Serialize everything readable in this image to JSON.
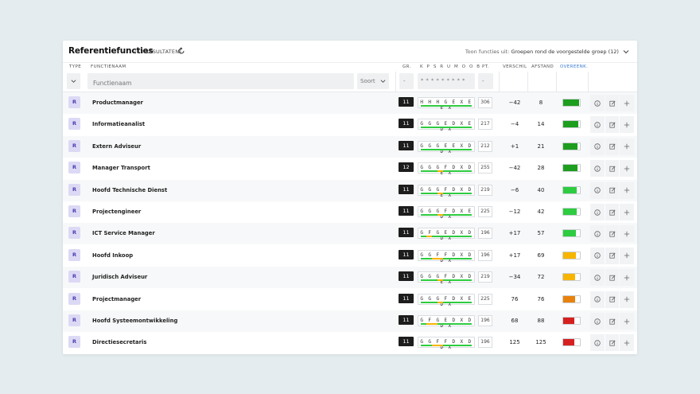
{
  "header": {
    "title": "Referentiefuncties",
    "count": "(43 RESULTATEN)",
    "filter_prefix": "Toon functies uit:",
    "filter_value": "Groepen rond de voorgestelde groep (12)"
  },
  "columns": {
    "type": "TYPE",
    "name": "FUNCTIENAAM",
    "gr": "GR.",
    "codes": "K P S R U M O O B",
    "pt": "PT.",
    "verschil": "VERSCHIL",
    "afstand": "AFSTAND",
    "overeenk": "OVEREENK."
  },
  "filters": {
    "name_placeholder": "Functienaam",
    "sort_label": "Soort",
    "gr_value": "-",
    "codes_value": "* * * * * * * * *",
    "pt_value": "-"
  },
  "colors": {
    "accent": "#3a7bd5",
    "badge_bg": "#dcd9f5",
    "badge_text": "#4b3fb0",
    "green_dark": "#1e9e1e",
    "green_light": "#2ecc40",
    "yellow": "#f7b500",
    "orange": "#e8820c",
    "red": "#d62020"
  },
  "rows": [
    {
      "type": "R",
      "name": "Productmanager",
      "gr": "11",
      "codes": "H H H G E X E E X",
      "pt": "306",
      "verschil": "−42",
      "afstand": "8",
      "match_level": 0.95,
      "match_color": "#1e9e1e",
      "code_colors": [
        "#2ecc40",
        "#2ecc40",
        "#2ecc40",
        "#2ecc40",
        "#2ecc40",
        "#2ecc40",
        "#2ecc40",
        "#2ecc40",
        "#2ecc40"
      ]
    },
    {
      "type": "R",
      "name": "Informatieanalist",
      "gr": "11",
      "codes": "G G G E D X E D X",
      "pt": "217",
      "verschil": "−4",
      "afstand": "14",
      "match_level": 0.9,
      "match_color": "#1e9e1e",
      "code_colors": [
        "#2ecc40",
        "#2ecc40",
        "#2ecc40",
        "#2ecc40",
        "#2ecc40",
        "#2ecc40",
        "#2ecc40",
        "#2ecc40",
        "#2ecc40"
      ]
    },
    {
      "type": "R",
      "name": "Extern Adviseur",
      "gr": "11",
      "codes": "G G G E E X D D X",
      "pt": "212",
      "verschil": "+1",
      "afstand": "21",
      "match_level": 0.88,
      "match_color": "#1e9e1e",
      "code_colors": [
        "#2ecc40",
        "#2ecc40",
        "#2ecc40",
        "#2ecc40",
        "#2ecc40",
        "#2ecc40",
        "#2ecc40",
        "#2ecc40",
        "#2ecc40"
      ]
    },
    {
      "type": "R",
      "name": "Manager Transport",
      "gr": "12",
      "codes": "G G G F D X D E X",
      "pt": "255",
      "verschil": "−42",
      "afstand": "28",
      "match_level": 0.85,
      "match_color": "#1e9e1e",
      "code_colors": [
        "#2ecc40",
        "#2ecc40",
        "#2ecc40",
        "#f7b500",
        "#2ecc40",
        "#2ecc40",
        "#2ecc40",
        "#2ecc40",
        "#2ecc40"
      ]
    },
    {
      "type": "R",
      "name": "Hoofd Technische Dienst",
      "gr": "11",
      "codes": "G G G F D X D E X",
      "pt": "219",
      "verschil": "−6",
      "afstand": "40",
      "match_level": 0.8,
      "match_color": "#2ecc40",
      "code_colors": [
        "#2ecc40",
        "#2ecc40",
        "#2ecc40",
        "#f7b500",
        "#2ecc40",
        "#2ecc40",
        "#2ecc40",
        "#2ecc40",
        "#2ecc40"
      ]
    },
    {
      "type": "R",
      "name": "Projectengineer",
      "gr": "11",
      "codes": "G G G F D X E D X",
      "pt": "225",
      "verschil": "−12",
      "afstand": "42",
      "match_level": 0.8,
      "match_color": "#2ecc40",
      "code_colors": [
        "#2ecc40",
        "#2ecc40",
        "#2ecc40",
        "#f7b500",
        "#2ecc40",
        "#2ecc40",
        "#2ecc40",
        "#2ecc40",
        "#2ecc40"
      ]
    },
    {
      "type": "R",
      "name": "ICT Service Manager",
      "gr": "11",
      "codes": "G F G E D X D D X",
      "pt": "196",
      "verschil": "+17",
      "afstand": "57",
      "match_level": 0.78,
      "match_color": "#2ecc40",
      "code_colors": [
        "#2ecc40",
        "#f7b500",
        "#2ecc40",
        "#2ecc40",
        "#2ecc40",
        "#2ecc40",
        "#2ecc40",
        "#2ecc40",
        "#2ecc40"
      ]
    },
    {
      "type": "R",
      "name": "Hoofd Inkoop",
      "gr": "11",
      "codes": "G G F F D X D D X",
      "pt": "196",
      "verschil": "+17",
      "afstand": "69",
      "match_level": 0.75,
      "match_color": "#f7b500",
      "code_colors": [
        "#2ecc40",
        "#2ecc40",
        "#f7b500",
        "#f7b500",
        "#2ecc40",
        "#2ecc40",
        "#2ecc40",
        "#2ecc40",
        "#2ecc40"
      ]
    },
    {
      "type": "R",
      "name": "Juridisch Adviseur",
      "gr": "11",
      "codes": "G G G F D X D E X",
      "pt": "219",
      "verschil": "−34",
      "afstand": "72",
      "match_level": 0.72,
      "match_color": "#f7b500",
      "code_colors": [
        "#2ecc40",
        "#2ecc40",
        "#2ecc40",
        "#f7b500",
        "#2ecc40",
        "#2ecc40",
        "#2ecc40",
        "#2ecc40",
        "#2ecc40"
      ]
    },
    {
      "type": "R",
      "name": "Projectmanager",
      "gr": "11",
      "codes": "G G G F D X E D X",
      "pt": "225",
      "verschil": "76",
      "afstand": "76",
      "match_level": 0.7,
      "match_color": "#e8820c",
      "code_colors": [
        "#2ecc40",
        "#2ecc40",
        "#2ecc40",
        "#f7b500",
        "#2ecc40",
        "#2ecc40",
        "#2ecc40",
        "#2ecc40",
        "#2ecc40"
      ]
    },
    {
      "type": "R",
      "name": "Hoofd Systeemontwikkeling",
      "gr": "11",
      "codes": "G F G E D X D D X",
      "pt": "196",
      "verschil": "68",
      "afstand": "88",
      "match_level": 0.65,
      "match_color": "#d62020",
      "code_colors": [
        "#2ecc40",
        "#f7b500",
        "#f7b500",
        "#2ecc40",
        "#2ecc40",
        "#2ecc40",
        "#2ecc40",
        "#2ecc40",
        "#2ecc40"
      ]
    },
    {
      "type": "R",
      "name": "Directiesecretaris",
      "gr": "11",
      "codes": "G G F F D X D D X",
      "pt": "196",
      "verschil": "125",
      "afstand": "125",
      "match_level": 0.65,
      "match_color": "#d62020",
      "code_colors": [
        "#2ecc40",
        "#2ecc40",
        "#f7b500",
        "#f7b500",
        "#2ecc40",
        "#2ecc40",
        "#2ecc40",
        "#2ecc40",
        "#2ecc40"
      ]
    }
  ]
}
